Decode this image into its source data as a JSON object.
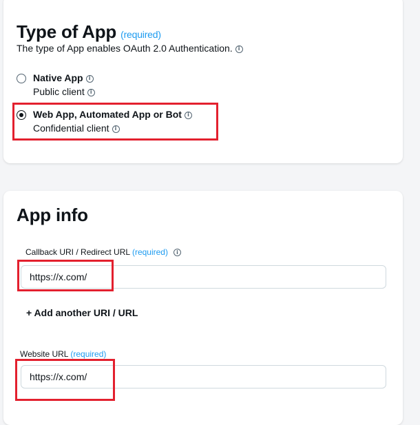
{
  "type_of_app": {
    "title": "Type of App",
    "required_label": "(required)",
    "subtitle": "The type of App enables OAuth 2.0 Authentication.",
    "options": [
      {
        "label": "Native App",
        "sublabel": "Public client",
        "selected": false
      },
      {
        "label": "Web App, Automated App or Bot",
        "sublabel": "Confidential client",
        "selected": true
      }
    ]
  },
  "app_info": {
    "title": "App info",
    "callback": {
      "label": "Callback URI / Redirect URL",
      "required_label": "(required)",
      "value": "https://x.com/"
    },
    "add_link": "+ Add another URI / URL",
    "website": {
      "label": "Website URL",
      "required_label": "(required)",
      "value": "https://x.com/"
    }
  },
  "colors": {
    "accent": "#1d9bf0",
    "highlight": "#e3202e",
    "text": "#0f1419"
  },
  "icons": [
    "info-icon"
  ]
}
